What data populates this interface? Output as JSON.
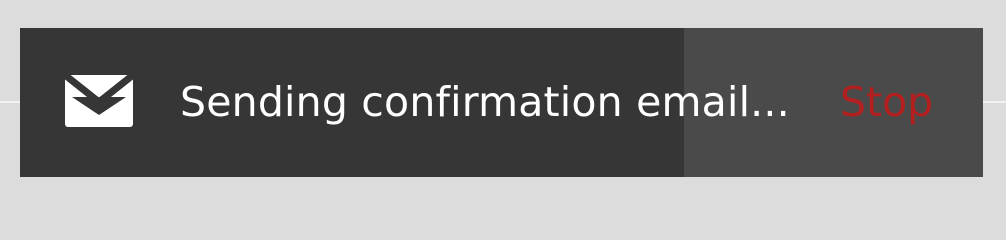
{
  "toast": {
    "icon": "envelope-icon",
    "message": "Sending confirmation email...",
    "action_label": "Stop",
    "progress_percent": 69,
    "colors": {
      "background": "#363636",
      "progress_remaining": "#4a4a4a",
      "message_text": "#ffffff",
      "action_text": "#b3201f",
      "page_background": "#dcdcdc"
    }
  }
}
